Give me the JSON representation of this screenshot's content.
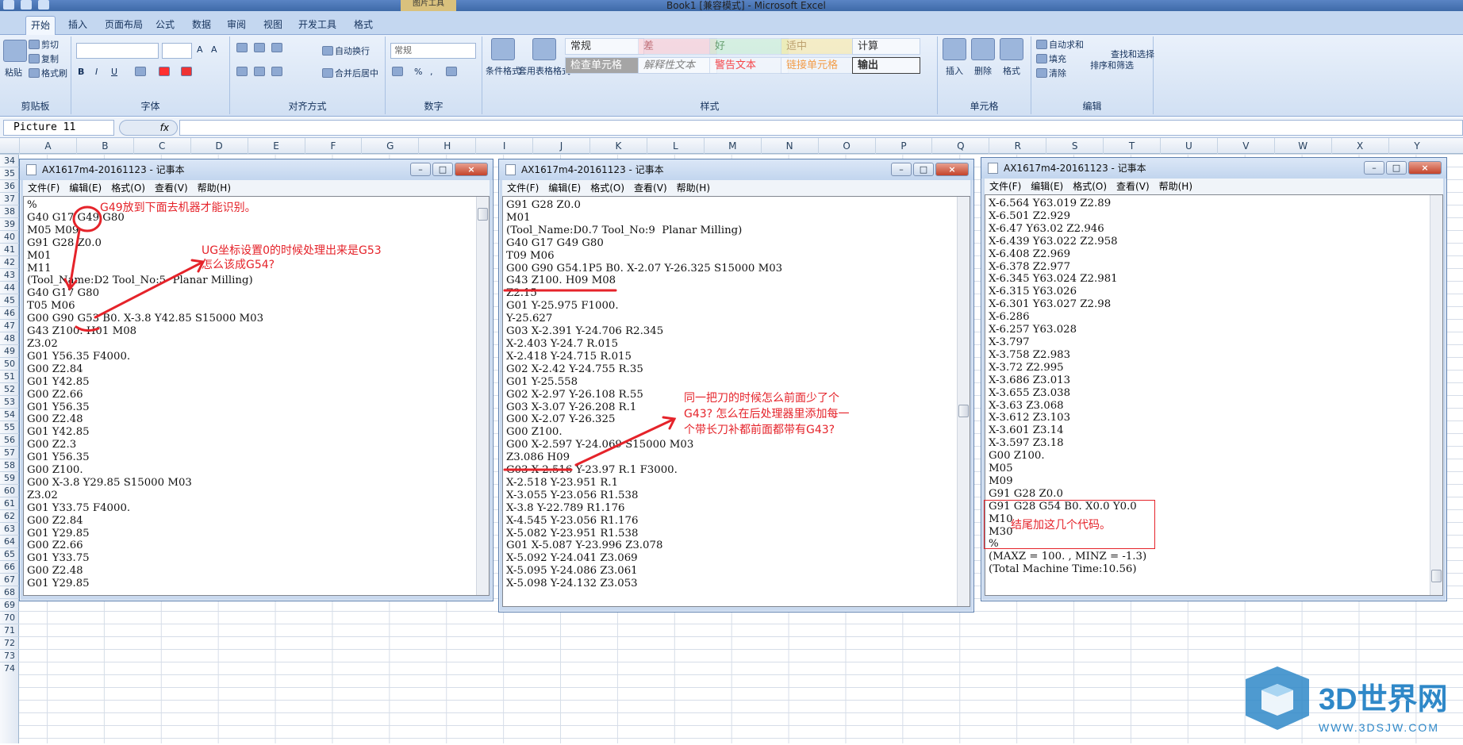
{
  "window": {
    "title": "Book1 [兼容模式] - Microsoft Excel",
    "context_tab": "图片工具"
  },
  "tabs": [
    "开始",
    "插入",
    "页面布局",
    "公式",
    "数据",
    "审阅",
    "视图",
    "开发工具",
    "格式"
  ],
  "ribbon": {
    "clipboard": {
      "label": "剪贴板",
      "paste": "粘贴",
      "cut": "剪切",
      "copy": "复制",
      "format_painter": "格式刷"
    },
    "font": {
      "label": "字体",
      "bold": "B",
      "italic": "I",
      "underline": "U",
      "grow": "A",
      "shrink": "A"
    },
    "alignment": {
      "label": "对齐方式",
      "wrap": "自动换行",
      "merge": "合并后居中"
    },
    "number": {
      "label": "数字",
      "format": "常规",
      "percent": "%",
      "comma": ","
    },
    "styles": {
      "label": "样式",
      "conditional": "条件格式",
      "table": "套用表格格式",
      "cells": [
        "常规",
        "差",
        "好",
        "适中",
        "计算",
        "检查单元格",
        "解释性文本",
        "警告文本",
        "链接单元格",
        "输出"
      ]
    },
    "cells": {
      "label": "单元格",
      "insert": "插入",
      "delete": "删除",
      "format": "格式"
    },
    "editing": {
      "label": "编辑",
      "autosum": "自动求和",
      "fill": "填充",
      "clear": "清除",
      "sort": "排序和筛选",
      "find": "查找和选择"
    }
  },
  "formula_bar": {
    "name_box": "Picture 11",
    "fx": "fx",
    "content": ""
  },
  "columns": [
    "A",
    "B",
    "C",
    "D",
    "E",
    "F",
    "G",
    "H",
    "I",
    "J",
    "K",
    "L",
    "M",
    "N",
    "O",
    "P",
    "Q",
    "R",
    "S",
    "T",
    "U",
    "V",
    "W",
    "X",
    "Y"
  ],
  "rows": [
    "34",
    "35",
    "36",
    "37",
    "38",
    "39",
    "40",
    "41",
    "42",
    "43",
    "44",
    "45",
    "46",
    "47",
    "48",
    "49",
    "50",
    "51",
    "52",
    "53",
    "54",
    "55",
    "56",
    "57",
    "58",
    "59",
    "60",
    "61",
    "62",
    "63",
    "64",
    "65",
    "66",
    "67",
    "68",
    "69",
    "70",
    "71",
    "72",
    "73",
    "74"
  ],
  "notepad_menu": [
    "文件(F)",
    "编辑(E)",
    "格式(O)",
    "查看(V)",
    "帮助(H)"
  ],
  "notepads": [
    {
      "title": "AX1617m4-20161123 - 记事本",
      "text": "%\nG40 G17 G49 G80\nM05 M09\nG91 G28 Z0.0\nM01\nM11\n(Tool_Name:D2 Tool_No:5  Planar Milling)\nG40 G17 G80\nT05 M06\nG00 G90 G53 B0. X-3.8 Y42.85 S15000 M03\nG43 Z100. H01 M08\nZ3.02\nG01 Y56.35 F4000.\nG00 Z2.84\nG01 Y42.85\nG00 Z2.66\nG01 Y56.35\nG00 Z2.48\nG01 Y42.85\nG00 Z2.3\nG01 Y56.35\nG00 Z100.\nG00 X-3.8 Y29.85 S15000 M03\nZ3.02\nG01 Y33.75 F4000.\nG00 Z2.84\nG01 Y29.85\nG00 Z2.66\nG01 Y33.75\nG00 Z2.48\nG01 Y29.85"
    },
    {
      "title": "AX1617m4-20161123 - 记事本",
      "text": "G91 G28 Z0.0\nM01\n(Tool_Name:D0.7 Tool_No:9  Planar Milling)\nG40 G17 G49 G80\nT09 M06\nG00 G90 G54.1P5 B0. X-2.07 Y-26.325 S15000 M03\nG43 Z100. H09 M08\nZ2.15\nG01 Y-25.975 F1000.\nY-25.627\nG03 X-2.391 Y-24.706 R2.345\nX-2.403 Y-24.7 R.015\nX-2.418 Y-24.715 R.015\nG02 X-2.42 Y-24.755 R.35\nG01 Y-25.558\nG02 X-2.97 Y-26.108 R.55\nG03 X-3.07 Y-26.208 R.1\nG00 X-2.07 Y-26.325\nG00 Z100.\nG00 X-2.597 Y-24.069 S15000 M03\nZ3.086 H09\nG03 X-2.516 Y-23.97 R.1 F3000.\nX-2.518 Y-23.951 R.1\nX-3.055 Y-23.056 R1.538\nX-3.8 Y-22.789 R1.176\nX-4.545 Y-23.056 R1.176\nX-5.082 Y-23.951 R1.538\nG01 X-5.087 Y-23.996 Z3.078\nX-5.092 Y-24.041 Z3.069\nX-5.095 Y-24.086 Z3.061\nX-5.098 Y-24.132 Z3.053"
    },
    {
      "title": "AX1617m4-20161123 - 记事本",
      "text": "X-6.564 Y63.019 Z2.89\nX-6.501 Z2.929\nX-6.47 Y63.02 Z2.946\nX-6.439 Y63.022 Z2.958\nX-6.408 Z2.969\nX-6.378 Z2.977\nX-6.345 Y63.024 Z2.981\nX-6.315 Y63.026\nX-6.301 Y63.027 Z2.98\nX-6.286\nX-6.257 Y63.028\nX-3.797\nX-3.758 Z2.983\nX-3.72 Z2.995\nX-3.686 Z3.013\nX-3.655 Z3.038\nX-3.63 Z3.068\nX-3.612 Z3.103\nX-3.601 Z3.14\nX-3.597 Z3.18\nG00 Z100.\nM05\nM09\nG91 G28 Z0.0\nG91 G28 G54 B0. X0.0 Y0.0\nM10\nM30\n%\n(MAXZ = 100. , MINZ = -1.3)\n(Total Machine Time:10.56)"
    }
  ],
  "annotations": {
    "a1": "G49放到下面去机器才能识别。",
    "a2": "UG坐标设置0的时候处理出来是G53",
    "a3": "怎么该成G54?",
    "a4": "同一把刀的时候怎么前面少了个",
    "a5": "G43? 怎么在后处理器里添加每一",
    "a6": "个带长刀补都前面都带有G43?",
    "a7": "结尾加这几个代码。"
  },
  "watermark": {
    "brand": "3D世界网",
    "url": "WWW.3DSJW.COM"
  },
  "colors": {
    "annotation": "#e5232a",
    "ribbon": "#d1e0f3"
  }
}
